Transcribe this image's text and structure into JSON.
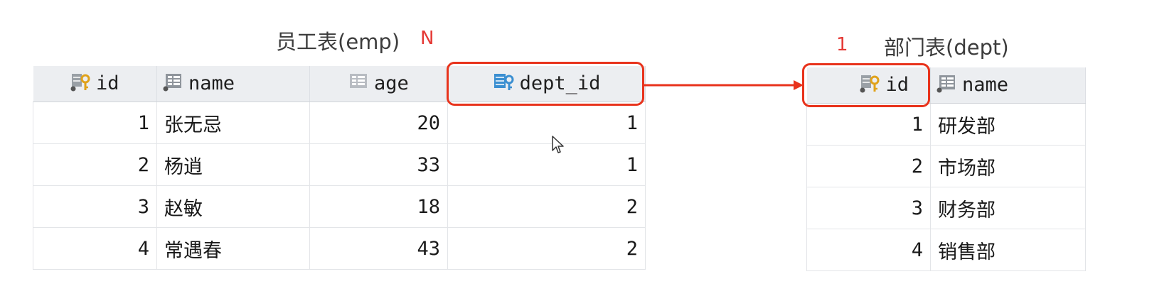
{
  "emp": {
    "title": "员工表(emp)",
    "cardinality": "N",
    "columns": [
      {
        "label": "id",
        "icon": "primary-key-icon"
      },
      {
        "label": "name",
        "icon": "column-icon"
      },
      {
        "label": "age",
        "icon": "column-icon"
      },
      {
        "label": "dept_id",
        "icon": "foreign-key-icon"
      }
    ],
    "rows": [
      {
        "id": "1",
        "name": "张无忌",
        "age": "20",
        "dept_id": "1"
      },
      {
        "id": "2",
        "name": "杨逍",
        "age": "33",
        "dept_id": "1"
      },
      {
        "id": "3",
        "name": "赵敏",
        "age": "18",
        "dept_id": "2"
      },
      {
        "id": "4",
        "name": "常遇春",
        "age": "43",
        "dept_id": "2"
      }
    ]
  },
  "dept": {
    "title": "部门表(dept)",
    "cardinality": "1",
    "columns": [
      {
        "label": "id",
        "icon": "primary-key-icon"
      },
      {
        "label": "name",
        "icon": "column-icon"
      }
    ],
    "rows": [
      {
        "id": "1",
        "name": "研发部"
      },
      {
        "id": "2",
        "name": "市场部"
      },
      {
        "id": "3",
        "name": "财务部"
      },
      {
        "id": "4",
        "name": "销售部"
      }
    ]
  },
  "colors": {
    "highlight": "#e8331c",
    "header_bg": "#eceef1",
    "key_gold": "#e0a21a",
    "fk_blue": "#3b8fd1"
  }
}
